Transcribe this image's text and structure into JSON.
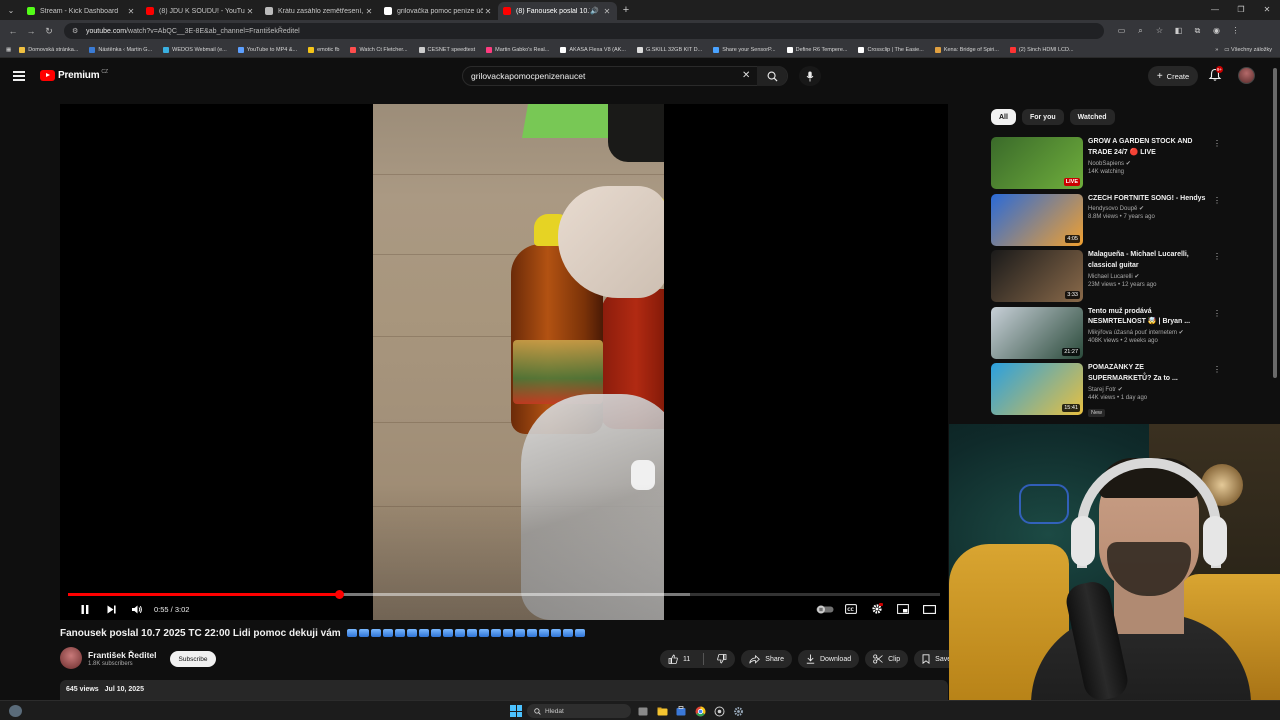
{
  "browser": {
    "tabs": [
      {
        "title": "Stream - Kick Dashboard",
        "color": "#53fc18",
        "active": false
      },
      {
        "title": "(8) JDU K SOUDU! - YouTube",
        "color": "#ff0000",
        "active": false
      },
      {
        "title": "Krátu zasáhlo zemětřesení, škoz",
        "color": "#bbbbbb",
        "active": false
      },
      {
        "title": "grilovačka pomoc peníze účet",
        "color": "#ffffff",
        "active": false
      },
      {
        "title": "(8) Fanousek poslal 10.7 20:",
        "color": "#ff0000",
        "active": true
      }
    ],
    "url_host": "youtube.com",
    "url_rest": "/watch?v=AbQC__3E-8E&ab_channel=FrantišekŘeditel",
    "bookmarks": [
      {
        "label": "Domovská stránka...",
        "color": "#f0c040"
      },
      {
        "label": "Nástěnka ‹ Martin G...",
        "color": "#3a7bd5"
      },
      {
        "label": "WEDOS Webmail (e...",
        "color": "#3ab0e0"
      },
      {
        "label": "YouTube to MP4 &...",
        "color": "#5da0ff"
      },
      {
        "label": "emotic fb",
        "color": "#f5c518"
      },
      {
        "label": "Watch Ct Fletcher...",
        "color": "#ff4d4d"
      },
      {
        "label": "CESNET speedtest",
        "color": "#cccccc"
      },
      {
        "label": "Martin Gabko's Real...",
        "color": "#ff3b7f"
      },
      {
        "label": "AKASA Flexa V8 (AK...",
        "color": "#ffffff"
      },
      {
        "label": "G.SKILL 32GB KIT D...",
        "color": "#dddddd"
      },
      {
        "label": "Share your SensorP...",
        "color": "#4aa3ff"
      },
      {
        "label": "Define R6 Tempere...",
        "color": "#ffffff"
      },
      {
        "label": "Crossclip | The Easie...",
        "color": "#ffffff"
      },
      {
        "label": "Kena: Bridge of Spiri...",
        "color": "#e0a040"
      },
      {
        "label": "(2) Sinch HDMI LCD...",
        "color": "#ff3333"
      }
    ],
    "bookmarks_all": "Všechny záložky"
  },
  "youtube": {
    "logo_text": "Premium",
    "country": "CZ",
    "search_value": "grilovackapomocpenizenaucet",
    "create_label": "Create",
    "notification_count": "9+"
  },
  "player": {
    "time_current": "0:55",
    "time_total": "3:02",
    "time_display": "0:55 / 3:02",
    "played_fraction": 0.311,
    "buffered_fraction": 0.713
  },
  "video": {
    "title": "Fanousek poslal 10.7 2025 TC 22:00 Lidi pomoc dekuji vám",
    "channel": "František Ředitel",
    "subscribers": "1.8K subscribers",
    "subscribe_label": "Subscribe",
    "likes": "11",
    "share_label": "Share",
    "download_label": "Download",
    "clip_label": "Clip",
    "save_label": "Save",
    "views": "645 views",
    "date": "Jul 10, 2025"
  },
  "sidebar": {
    "chips": [
      "All",
      "For you",
      "Watched"
    ],
    "recommendations": [
      {
        "title": "GROW A GARDEN STOCK AND TRADE 24/7 🔴 LIVE",
        "channel": "NoobSapiens",
        "meta": "14K watching",
        "badge": "LIVE",
        "thumb_a": "#3a6a2a",
        "thumb_b": "#6fae3c"
      },
      {
        "title": "CZECH FORTNITE SONG! - Hendys",
        "channel": "Hendysovo Doupě",
        "meta": "8.8M views • 7 years ago",
        "badge": "4:05",
        "thumb_a": "#2a6ad8",
        "thumb_b": "#f0a030"
      },
      {
        "title": "Malagueña - Michael Lucarelli, classical guitar",
        "channel": "Michael Lucarelli",
        "meta": "23M views • 12 years ago",
        "badge": "3:33",
        "thumb_a": "#1a1a1a",
        "thumb_b": "#8a6a4a"
      },
      {
        "title": "Tento muž prodává NESMRTELNOST 🤯 | Bryan ...",
        "channel": "Mikýřova úžasná pouť internetem",
        "meta": "408K views • 2 weeks ago",
        "badge": "21:27",
        "thumb_a": "#c8d0d8",
        "thumb_b": "#2a4a3a"
      },
      {
        "title": "POMAZÁNKY ZE SUPERMARKETŮ? Za to ...",
        "channel": "Starej Fotr",
        "meta": "44K views • 1 day ago",
        "badge": "15:41",
        "new": "New",
        "thumb_a": "#2aa0e0",
        "thumb_b": "#e8c040"
      }
    ]
  },
  "taskbar": {
    "search_placeholder": "Hledat"
  }
}
